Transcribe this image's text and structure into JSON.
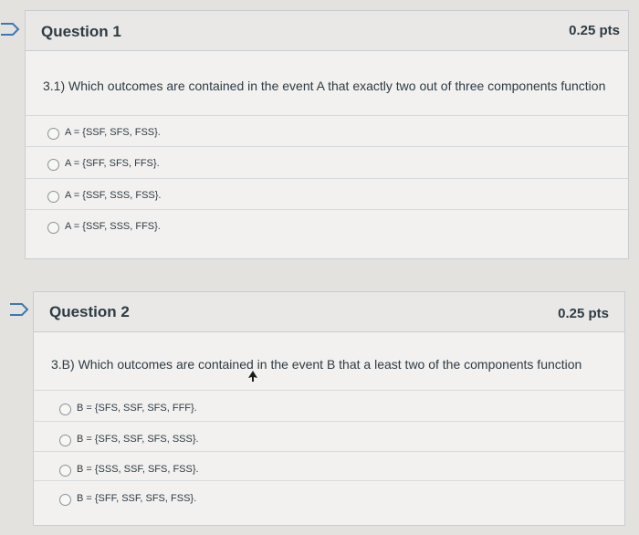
{
  "questions": [
    {
      "title": "Question 1",
      "points": "0.25 pts",
      "text": "3.1) Which outcomes are contained in the event A that exactly two out of three components function",
      "answers": [
        "A = {SSF, SFS, FSS}.",
        "A = {SFF, SFS, FFS}.",
        "A = {SSF, SSS, FSS}.",
        "A = {SSF, SSS, FFS}."
      ]
    },
    {
      "title": "Question 2",
      "points": "0.25 pts",
      "text": "3.B) Which outcomes are contained in the event B that a least two of the components function",
      "answers": [
        "B = {SFS, SSF, SFS, FFF}.",
        "B = {SFS, SSF, SFS, SSS}.",
        "B = {SSS, SSF, SFS, FSS}.",
        "B = {SFF, SSF, SFS, FSS}."
      ]
    }
  ],
  "colors": {
    "flag": "#3b79b4",
    "page_bg": "#e4e2df",
    "card_bg": "#f2f1ef",
    "header_bg": "#e9e8e6"
  },
  "icons": [
    "flag-icon",
    "mouse-cursor-icon"
  ]
}
